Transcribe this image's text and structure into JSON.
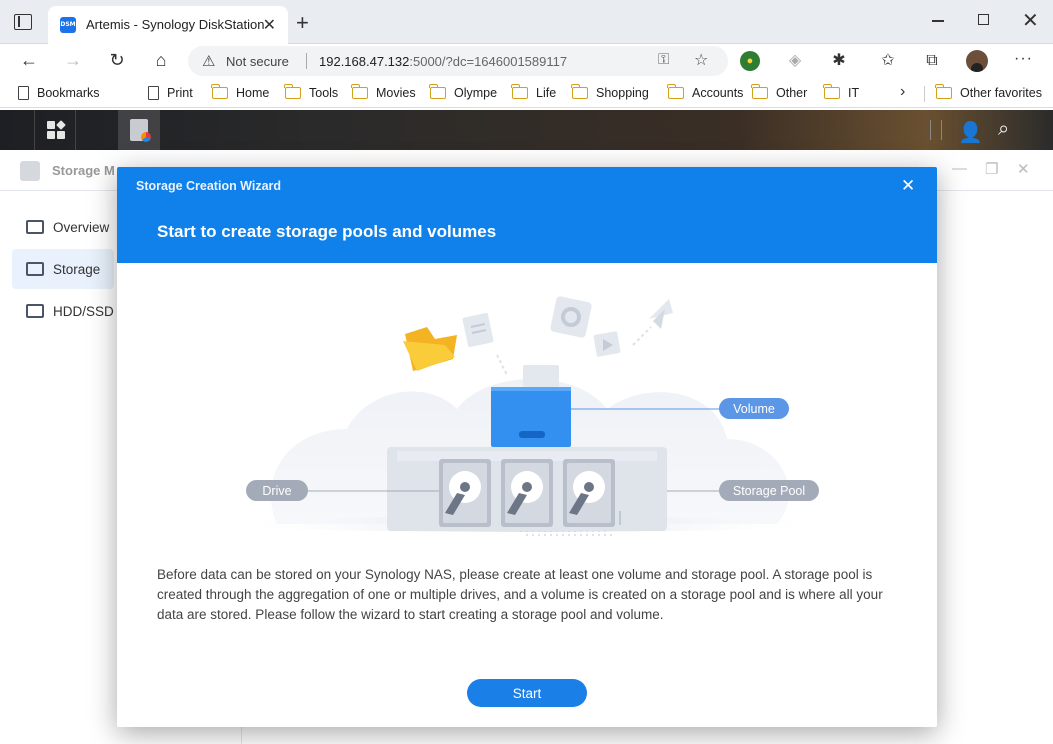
{
  "browser": {
    "tab_title": "Artemis - Synology DiskStation",
    "tab_favicon_text": "DSM",
    "not_secure": "Not secure",
    "url_host": "192.168.47.132",
    "url_rest": ":5000/?dc=1646001589117",
    "bookmarks": [
      {
        "label": "Bookmarks",
        "icon": "bookmarks-icon"
      },
      {
        "label": "Print",
        "icon": "page-icon"
      },
      {
        "label": "Home",
        "icon": "folder-icon"
      },
      {
        "label": "Tools",
        "icon": "folder-icon"
      },
      {
        "label": "Movies",
        "icon": "folder-icon"
      },
      {
        "label": "Olympe",
        "icon": "folder-icon"
      },
      {
        "label": "Life",
        "icon": "folder-icon"
      },
      {
        "label": "Shopping",
        "icon": "folder-icon"
      },
      {
        "label": "Accounts",
        "icon": "folder-icon"
      },
      {
        "label": "Other",
        "icon": "folder-icon"
      },
      {
        "label": "IT",
        "icon": "folder-icon"
      }
    ],
    "other_favorites": "Other favorites"
  },
  "app": {
    "title": "Storage Manager",
    "nav": [
      {
        "label": "Overview",
        "active": false
      },
      {
        "label": "Storage",
        "active": true
      },
      {
        "label": "HDD/SSD",
        "active": false
      }
    ]
  },
  "wizard": {
    "window_title": "Storage Creation Wizard",
    "heading": "Start to create storage pools and volumes",
    "labels": {
      "volume": "Volume",
      "drive": "Drive",
      "storage_pool": "Storage Pool"
    },
    "description": "Before data can be stored on your Synology NAS, please create at least one volume and storage pool. A storage pool is created through the aggregation of one or multiple drives, and a volume is created on a storage pool and is where all your data are stored. Please follow the wizard to start creating a storage pool and volume.",
    "start_button": "Start"
  },
  "colors": {
    "accent": "#1080ea",
    "label_pill": "#5b97e6",
    "label_pill_gray": "#a3aab8"
  }
}
